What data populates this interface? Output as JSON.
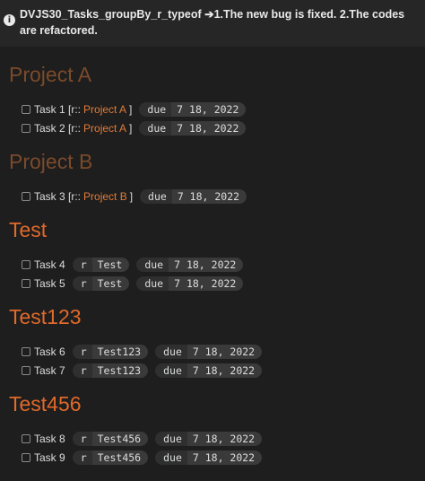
{
  "banner": {
    "icon": "info-icon",
    "text": "DVJS30_Tasks_groupBy_r_typeof ➔1.The new bug is fixed. 2.The codes are refactored."
  },
  "groups": [
    {
      "title": "Project A",
      "tasks": [
        {
          "label": "Task 1 [r::",
          "link": "Project A",
          "close": "]",
          "due_key": "due",
          "due_value": "7 18, 2022"
        },
        {
          "label": "Task 2 [r::",
          "link": "Project A",
          "close": "]",
          "due_key": "due",
          "due_value": "7 18, 2022"
        }
      ]
    },
    {
      "title": "Project B",
      "tasks": [
        {
          "label": "Task 3 [r::",
          "link": "Project B",
          "close": "]",
          "due_key": "due",
          "due_value": "7 18, 2022"
        }
      ]
    },
    {
      "title": "Test",
      "tasks": [
        {
          "label": "Task 4",
          "r_key": "r",
          "r_value": "Test",
          "due_key": "due",
          "due_value": "7 18, 2022"
        },
        {
          "label": "Task 5",
          "r_key": "r",
          "r_value": "Test",
          "due_key": "due",
          "due_value": "7 18, 2022"
        }
      ]
    },
    {
      "title": "Test123",
      "tasks": [
        {
          "label": "Task 6",
          "r_key": "r",
          "r_value": "Test123",
          "due_key": "due",
          "due_value": "7 18, 2022"
        },
        {
          "label": "Task 7",
          "r_key": "r",
          "r_value": "Test123",
          "due_key": "due",
          "due_value": "7 18, 2022"
        }
      ]
    },
    {
      "title": "Test456",
      "tasks": [
        {
          "label": "Task 8",
          "r_key": "r",
          "r_value": "Test456",
          "due_key": "due",
          "due_value": "7 18, 2022"
        },
        {
          "label": "Task 9",
          "r_key": "r",
          "r_value": "Test456",
          "due_key": "due",
          "due_value": "7 18, 2022"
        }
      ]
    }
  ],
  "colors": {
    "background": "#1e1e1e",
    "heading_dim": "#7b4a2b",
    "heading_bright": "#e0692b",
    "link": "#e07b39"
  }
}
